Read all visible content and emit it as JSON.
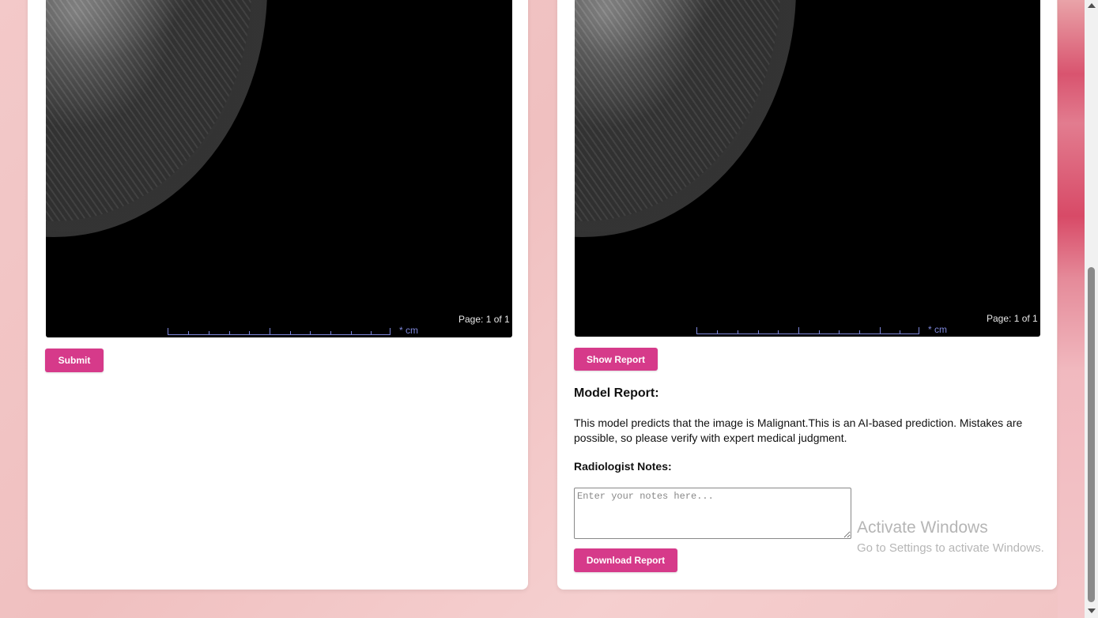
{
  "viewers": {
    "left": {
      "page_label": "Page: 1 of 1",
      "unit_label": "* cm"
    },
    "right": {
      "page_label": "Page: 1 of 1",
      "unit_label": "* cm"
    }
  },
  "left_panel": {
    "submit_label": "Submit"
  },
  "right_panel": {
    "show_report_label": "Show Report",
    "model_report_heading": "Model Report:",
    "model_report_text": "This model predicts that the image is Malignant.This is an AI-based prediction. Mistakes are possible, so please verify with expert medical judgment.",
    "notes_heading": "Radiologist Notes:",
    "notes_placeholder": "Enter your notes here...",
    "notes_value": "",
    "download_label": "Download Report"
  },
  "watermark": {
    "title": "Activate Windows",
    "subtitle": "Go to Settings to activate Windows."
  },
  "colors": {
    "accent": "#d63a8a",
    "ruler": "#7d86d9"
  }
}
